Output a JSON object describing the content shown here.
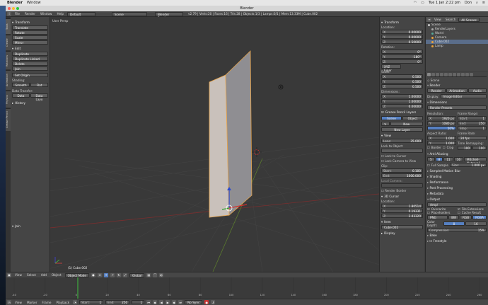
{
  "macbar": {
    "app": "Blender",
    "menu": "Window",
    "clock": "Tue 1 Jan  2:22 pm",
    "user": "Don"
  },
  "window": {
    "title": "Blender"
  },
  "info": {
    "menus": [
      "File",
      "Render",
      "Window",
      "Help"
    ],
    "layout": "Default",
    "scene": "Scene",
    "engine": "Blender Render",
    "stats": "v2.79 | Verts:20 | Faces:16 | Tris:28 | Objects:1/3 | Lamps:0/1 | Mem:13.33M | Cube.002"
  },
  "shelf_tabs": [
    "Tools",
    "Create",
    "Relations",
    "Animation",
    "Physics",
    "Grease Pencil"
  ],
  "toolshelf": {
    "transform_header": "Transform",
    "transform_buttons": [
      "Translate",
      "Rotate",
      "Scale",
      "Mirror"
    ],
    "edit_header": "Edit",
    "edit_buttons": [
      "Duplicate",
      "Duplicate Linked",
      "Delete",
      "Join"
    ],
    "set_origin": "Set Origin",
    "shading_label": "Shading:",
    "smooth": "Smooth",
    "flat": "Flat",
    "data_transfer_label": "Data Transfer:",
    "data": "Data",
    "data_layout": "Data Layo",
    "history_header": "History",
    "join_label": "Join"
  },
  "viewport": {
    "label": "User Persp",
    "object_label": "(1) Cube.002"
  },
  "npanel": {
    "transform_header": "Transform",
    "location_label": "Location:",
    "location": [
      {
        "k": "X:",
        "v": "0.00000"
      },
      {
        "k": "Y:",
        "v": "0.00000"
      },
      {
        "k": "Z:",
        "v": "0.50000"
      }
    ],
    "rotation_label": "Rotation:",
    "rotation": [
      {
        "k": "X:",
        "v": "0°"
      },
      {
        "k": "Y:",
        "v": "-180°"
      },
      {
        "k": "Z:",
        "v": "0°"
      }
    ],
    "rotation_mode": "XYZ Euler",
    "scale_label": "Scale:",
    "scale": [
      {
        "k": "X:",
        "v": "0.500"
      },
      {
        "k": "Y:",
        "v": "0.500"
      },
      {
        "k": "Z:",
        "v": "0.500"
      }
    ],
    "dimensions_label": "Dimensions:",
    "dimensions": [
      {
        "k": "X:",
        "v": "1.00000"
      },
      {
        "k": "Y:",
        "v": "1.00000"
      },
      {
        "k": "Z:",
        "v": "0.00000"
      }
    ],
    "grease_header": "Grease Pencil Layers",
    "scene_btn": "Scene",
    "object_btn": "Object",
    "new_btn": "New",
    "new_layer_btn": "New Layer",
    "view_header": "View",
    "lens_label": "Lens:",
    "lens": "35.000",
    "lock_object_label": "Lock to Object:",
    "lock_cursor": "Lock to Cursor",
    "lock_camera": "Lock Camera to View",
    "clip_label": "Clip:",
    "clip_start_k": "Start:",
    "clip_start": "0.100",
    "clip_end_k": "End:",
    "clip_end": "1000.000",
    "local_camera": "Local Camera:",
    "render_border": "Render Border",
    "cursor_header": "3D Cursor",
    "cursor_location_label": "Location:",
    "cursor": [
      {
        "k": "X:",
        "v": "1.80514"
      },
      {
        "k": "Y:",
        "v": "0.19331"
      },
      {
        "k": "Z:",
        "v": "2.43320"
      }
    ],
    "item_header": "Item",
    "item_name": "Cube.002",
    "display_header": "Display"
  },
  "outliner": {
    "view": "View",
    "search": "Search",
    "filter": "All Scenes",
    "items": [
      "Scene",
      "RenderLayers",
      "World",
      "Camera",
      "Cube.002",
      "Lamp"
    ]
  },
  "properties": {
    "breadcrumb": "Scene",
    "render_header": "Render",
    "render_btns": [
      "Render",
      "Animation",
      "Audio"
    ],
    "display_label": "Display:",
    "display_value": "Image Editor",
    "dimensions_header": "Dimensions",
    "presets": "Render Presets",
    "resolution_label": "Resolution:",
    "res_x": "1920 px",
    "res_y": "1080 px",
    "res_pct": "50%",
    "frame_range_label": "Frame Range:",
    "start_frame": "1",
    "end_frame": "250",
    "frame_step": "1",
    "aspect_label": "Aspect Ratio:",
    "aspect_x": "1.000",
    "aspect_y": "1.000",
    "frame_rate_label": "Frame Rate:",
    "frame_rate": "24 fps",
    "time_remap_label": "Time Remapping:",
    "time_old": "100",
    "time_new": "100",
    "border": "Border",
    "crop": "Crop",
    "aa_header": "Anti-Aliasing",
    "aa_samples": [
      "5",
      "8",
      "11",
      "16"
    ],
    "aa_filter": "Mitchell-Netravali",
    "full_sample": "Full Sample",
    "size_label": "Size:",
    "size": "1.000 px",
    "collapsed": [
      "Sampled Motion Blur",
      "Shading",
      "Performance",
      "Post Processing",
      "Metadata"
    ],
    "output_header": "Output",
    "output_path": "/tmp/",
    "overwrite": "Overwrite",
    "file_ext": "File Extensions",
    "placeholders": "Placeholders",
    "cache": "Cache Result",
    "format": "PNG",
    "bw": "BW",
    "rgb": "RGB",
    "rgba": "RGBA",
    "color_depth_label": "Color Depth:",
    "depth_8": "8",
    "depth_16": "16",
    "compression_label": "Compression:",
    "compression": "15%",
    "bake": "Bake",
    "freestyle": "Freestyle"
  },
  "timeline": {
    "menus": [
      "View",
      "Marker",
      "Frame",
      "Playback"
    ],
    "start": "Start:",
    "start_val": "1",
    "end": "End:",
    "end_val": "250",
    "current": "1",
    "sync": "No Sync",
    "ticks": [
      "-40",
      "-20",
      "0",
      "20",
      "40",
      "60",
      "80",
      "100",
      "120",
      "140",
      "160",
      "180",
      "200",
      "220",
      "240",
      "260"
    ]
  },
  "view3d_header": {
    "menus": [
      "View",
      "Select",
      "Add",
      "Object"
    ],
    "mode": "Object Mode",
    "orientation": "Global"
  }
}
